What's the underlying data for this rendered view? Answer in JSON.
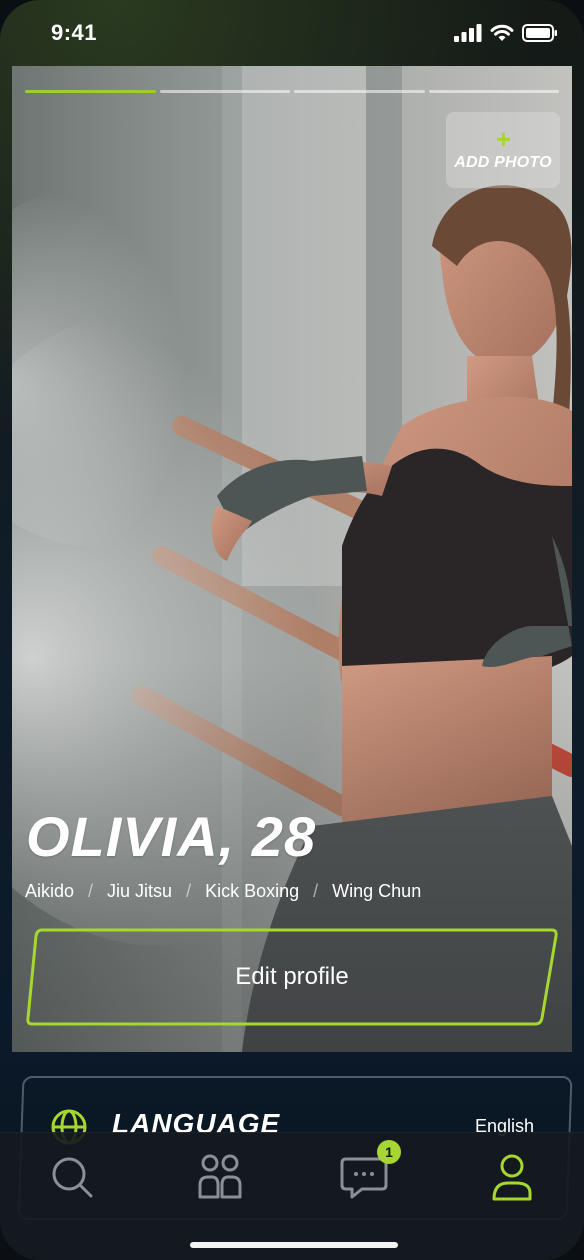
{
  "status": {
    "time": "9:41"
  },
  "profile": {
    "name": "OLIVIA, 28",
    "add_photo_label": "ADD PHOTO",
    "photo_progress": {
      "total": 4,
      "current": 1
    },
    "disciplines": [
      "Aikido",
      "Jiu Jitsu",
      "Kick Boxing",
      "Wing Chun"
    ],
    "edit_label": "Edit profile"
  },
  "language": {
    "title": "LANGUAGE",
    "value": "English"
  },
  "tabbar": {
    "items": [
      {
        "icon": "search-icon"
      },
      {
        "icon": "groups-icon"
      },
      {
        "icon": "chat-icon",
        "badge": "1"
      },
      {
        "icon": "profile-icon",
        "active": true
      }
    ]
  },
  "colors": {
    "accent": "#a6d630",
    "background": "#0f1c2a"
  }
}
